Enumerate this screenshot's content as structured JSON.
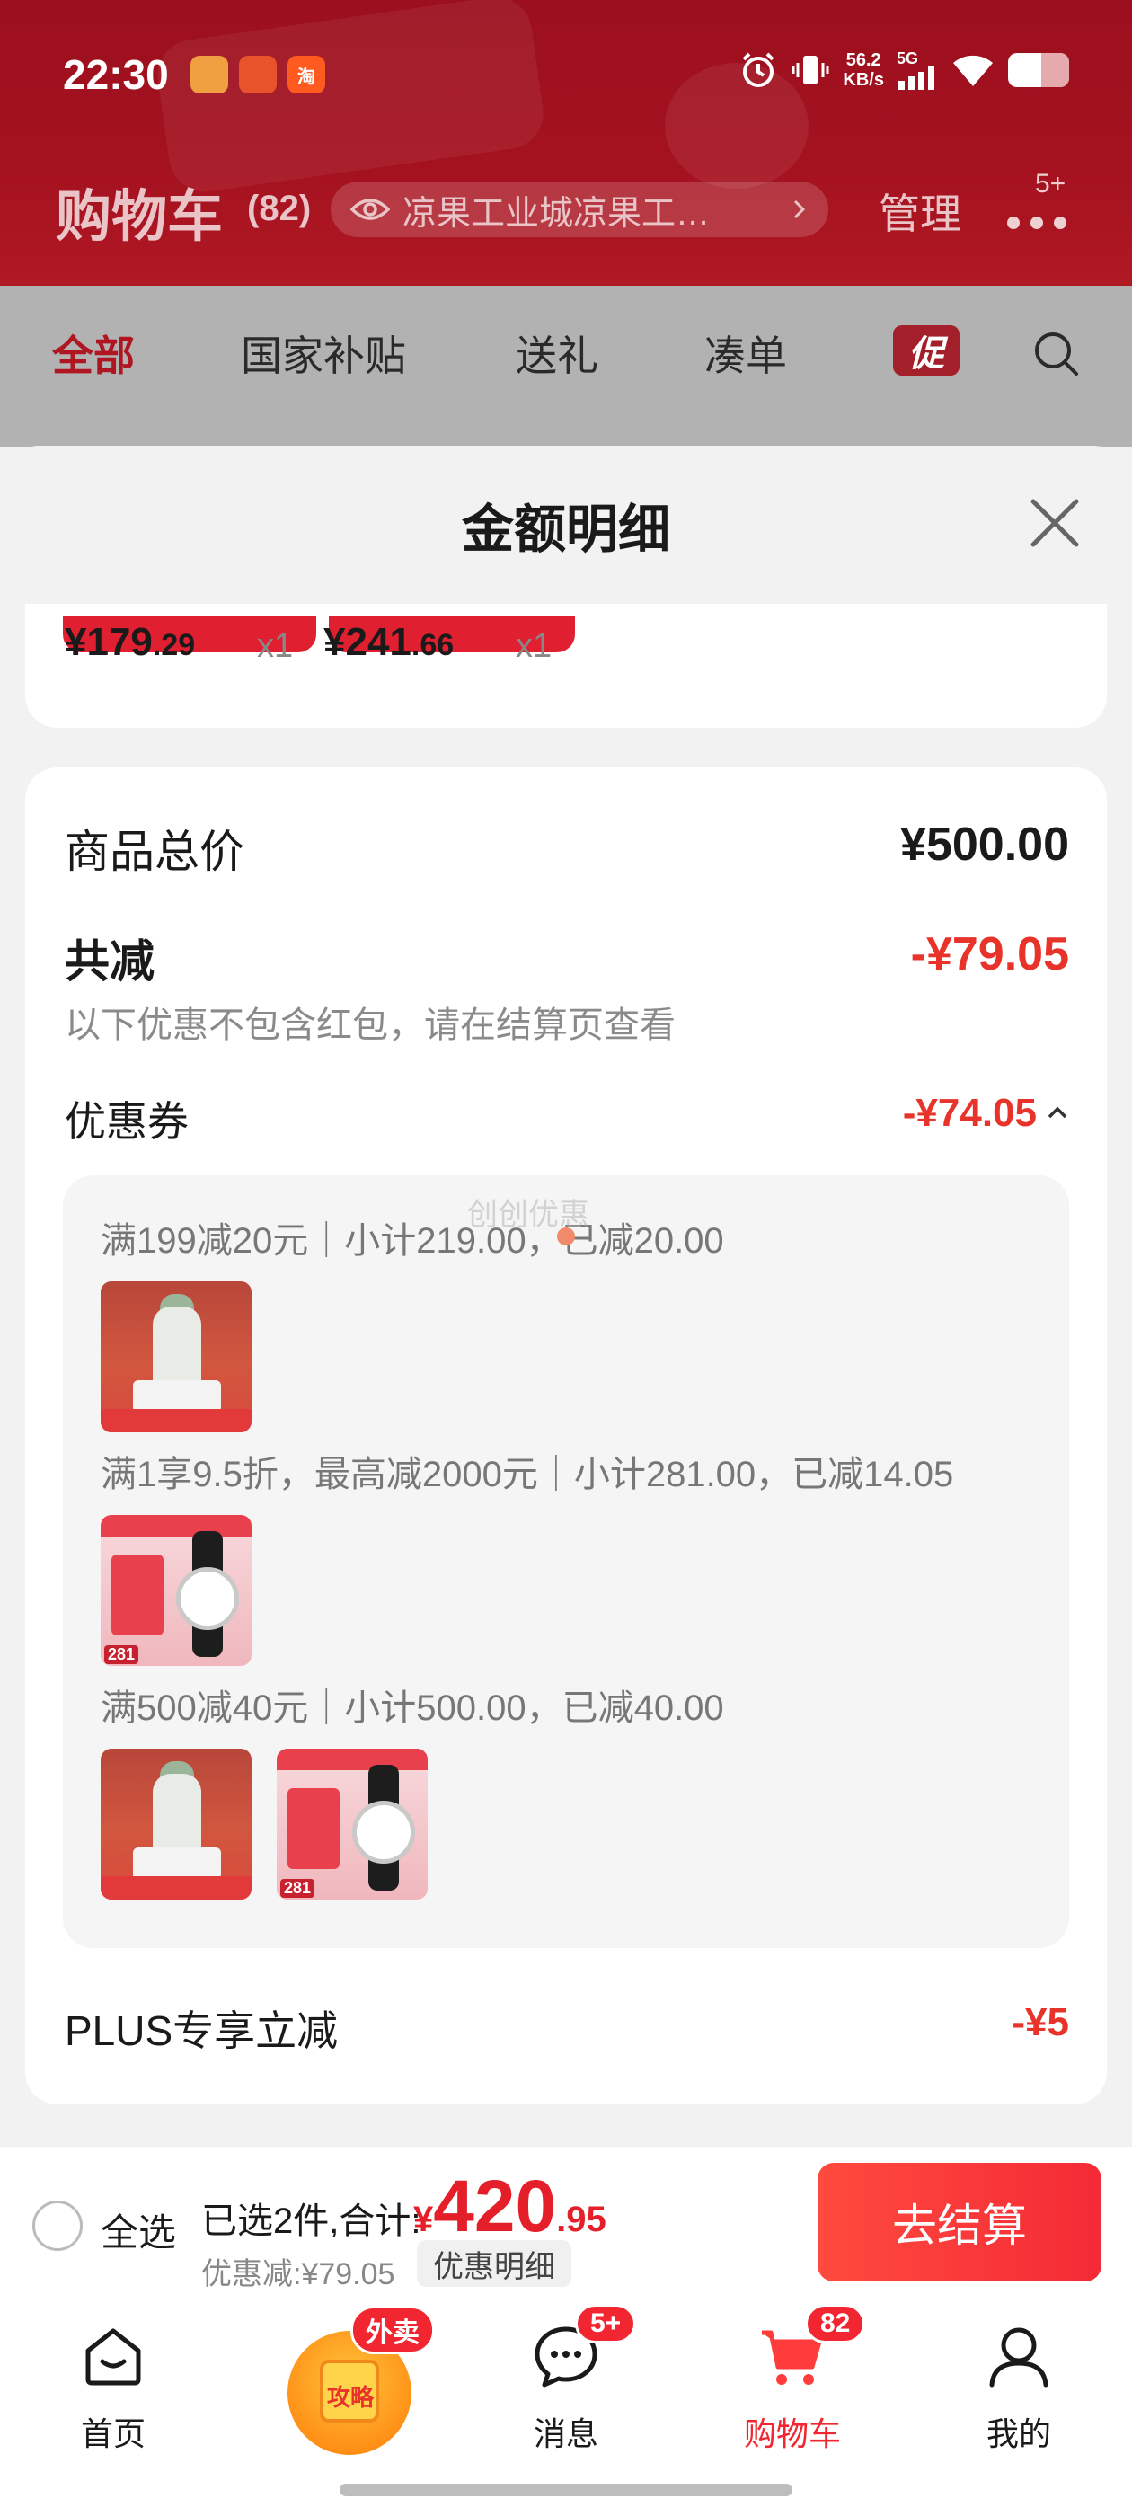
{
  "status_bar": {
    "time": "22:30",
    "app_icons": [
      {
        "label": "",
        "color": "#f0a040"
      },
      {
        "label": "",
        "color": "#e8532b"
      },
      {
        "label": "淘",
        "color": "#ff5a1f"
      }
    ],
    "net_speed_value": "56.2",
    "net_speed_unit": "KB/s",
    "network": "5G",
    "icons": [
      "alarm-icon",
      "vibrate-icon",
      "signal-icon",
      "wifi-icon",
      "battery-icon"
    ],
    "battery_level": 0.55
  },
  "header": {
    "title": "购物车",
    "count": "(82)",
    "address": "凉果工业城凉果工…",
    "manage": "管理",
    "more_badge": "5+"
  },
  "tabs": [
    {
      "label": "全部",
      "active": true
    },
    {
      "label": "国家补贴",
      "active": false
    },
    {
      "label": "送礼",
      "active": false
    },
    {
      "label": "凑单",
      "active": false
    },
    {
      "label": "促",
      "active": false
    }
  ],
  "sheet": {
    "title": "金额明细",
    "top_items": [
      {
        "price_int": "¥179",
        "price_dec": ".29",
        "qty": "x1"
      },
      {
        "price_int": "¥241",
        "price_dec": ".66",
        "qty": "x1"
      }
    ],
    "goods_total_label": "商品总价",
    "goods_total_value": "¥500.00",
    "reduce_label": "共减",
    "reduce_value": "-¥79.05",
    "reduce_note": "以下优惠不包含红包，请在结算页查看",
    "coupon_label": "优惠券",
    "coupon_value": "-¥74.05",
    "coupons": [
      {
        "text": "满199减20元｜小计219.00，已减20.00",
        "thumbs": [
          "bottle"
        ]
      },
      {
        "text": "满1享9.5折，最高减2000元｜小计281.00，已减14.05",
        "thumbs": [
          "watch"
        ]
      },
      {
        "text": "满500减40元｜小计500.00，已减40.00",
        "thumbs": [
          "bottle",
          "watch"
        ]
      }
    ],
    "watch_thumb_price": "281",
    "watermark": "创创优惠",
    "plus_label": "PLUS专享立减",
    "plus_value": "-¥5"
  },
  "checkout": {
    "select_all": "全选",
    "selected_prefix": "已选2件,合计:",
    "total_currency": "¥",
    "total_int": "420",
    "total_dec": ".95",
    "discount_text": "优惠减:¥79.05",
    "detail_button": "优惠明细",
    "checkout_button": "去结算"
  },
  "bottom_nav": [
    {
      "label": "首页",
      "icon": "home-icon",
      "active": false
    },
    {
      "label": "",
      "icon": "takeout-icon",
      "badge": "外卖",
      "inner": "攻略",
      "active": false
    },
    {
      "label": "消息",
      "icon": "message-icon",
      "badge": "5+",
      "active": false
    },
    {
      "label": "购物车",
      "icon": "cart-icon",
      "badge": "82",
      "active": true
    },
    {
      "label": "我的",
      "icon": "profile-icon",
      "active": false
    }
  ],
  "colors": {
    "brand_red": "#e51f2a",
    "header_red": "#a5121f",
    "discount_red": "#e8332a"
  }
}
